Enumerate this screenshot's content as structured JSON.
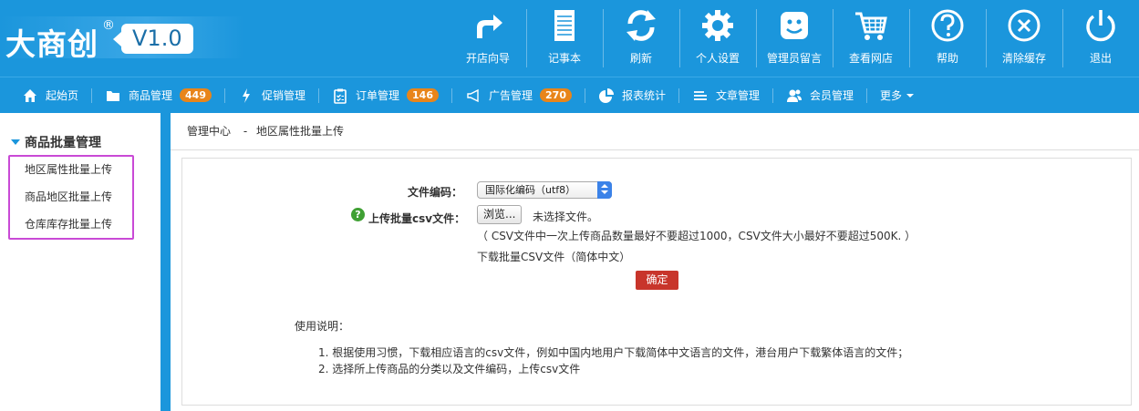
{
  "brand": {
    "logo_text": "大商创",
    "reg_mark": "®",
    "version": "V1.0"
  },
  "toolbar": [
    {
      "label": "开店向导",
      "icon": "share-arrow-icon"
    },
    {
      "label": "记事本",
      "icon": "notepad-icon"
    },
    {
      "label": "刷新",
      "icon": "refresh-icon"
    },
    {
      "label": "个人设置",
      "icon": "gear-icon"
    },
    {
      "label": "管理员留言",
      "icon": "smiley-icon"
    },
    {
      "label": "查看网店",
      "icon": "cart-icon"
    },
    {
      "label": "帮助",
      "icon": "help-icon"
    },
    {
      "label": "清除缓存",
      "icon": "close-circle-icon"
    },
    {
      "label": "退出",
      "icon": "power-icon"
    }
  ],
  "nav": {
    "home": "起始页",
    "goods": "商品管理",
    "goods_count": "449",
    "promo": "促销管理",
    "orders": "订单管理",
    "orders_count": "146",
    "ads": "广告管理",
    "ads_count": "270",
    "reports": "报表统计",
    "articles": "文章管理",
    "members": "会员管理",
    "more": "更多"
  },
  "sidebar": {
    "title": "商品批量管理",
    "items": [
      "地区属性批量上传",
      "商品地区批量上传",
      "仓库库存批量上传"
    ]
  },
  "breadcrumb": {
    "root": "管理中心",
    "sep": "-",
    "current": "地区属性批量上传"
  },
  "form": {
    "encoding_label": "文件编码：",
    "encoding_value": "国际化编码（utf8）",
    "upload_label": "上传批量csv文件：",
    "browse_label": "浏览...",
    "no_file": "未选择文件。",
    "hint": "（ CSV文件中一次上传商品数量最好不要超过1000，CSV文件大小最好不要超过500K. ）",
    "download_link": "下载批量CSV文件（简体中文）",
    "confirm": "确定"
  },
  "instructions": {
    "title": "使用说明：",
    "items": [
      "1. 根据使用习惯，下载相应语言的csv文件，例如中国内地用户下载简体中文语言的文件，港台用户下载繁体语言的文件；",
      "2. 选择所上传商品的分类以及文件编码，上传csv文件"
    ]
  },
  "colors": {
    "primary": "#1b96dc",
    "badge": "#e8851a",
    "confirm": "#c8352b",
    "highlight": "#c94ad6"
  }
}
